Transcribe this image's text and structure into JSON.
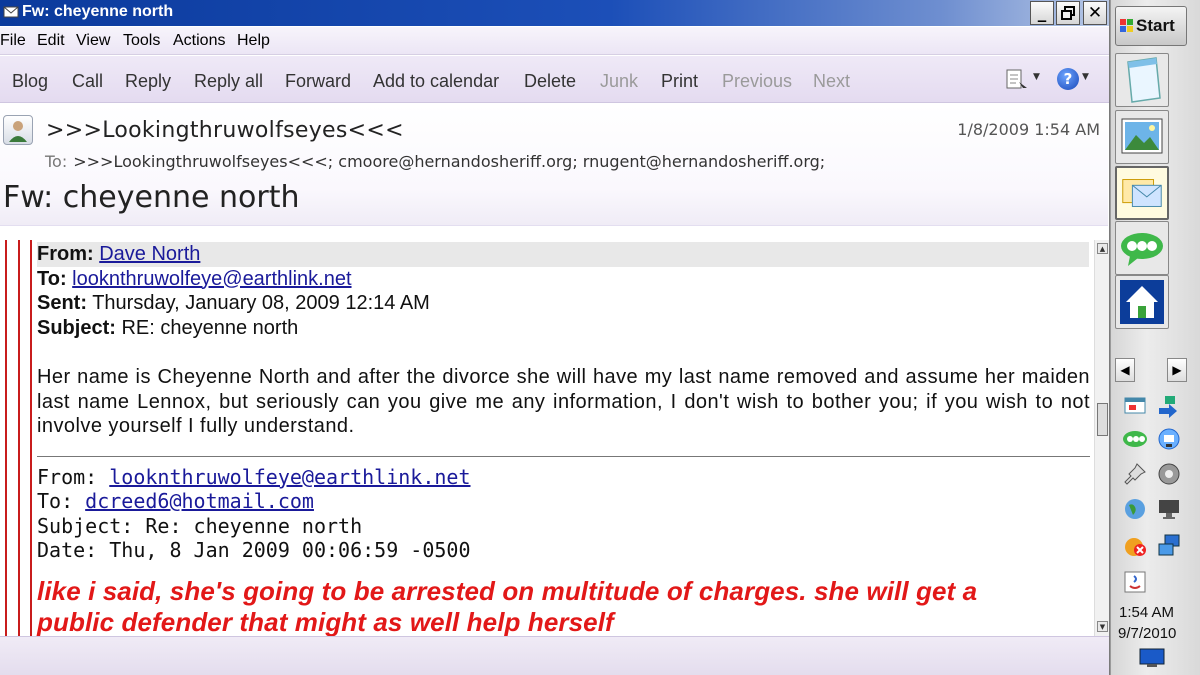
{
  "window": {
    "title": "Fw: cheyenne north"
  },
  "menu": [
    "File",
    "Edit",
    "View",
    "Tools",
    "Actions",
    "Help"
  ],
  "toolbar": {
    "blog": "Blog",
    "call": "Call",
    "reply": "Reply",
    "reply_all": "Reply all",
    "forward": "Forward",
    "add_to_calendar": "Add to calendar",
    "delete": "Delete",
    "junk": "Junk",
    "print": "Print",
    "previous": "Previous",
    "next": "Next"
  },
  "header": {
    "sender": ">>>Lookingthruwolfseyes<<<",
    "date": "1/8/2009 1:54 AM",
    "to_label": "To:",
    "to_value": ">>>Lookingthruwolfseyes<<<; cmoore@hernandosheriff.org; rnugent@hernandosheriff.org;",
    "subject": "Fw: cheyenne north"
  },
  "message": {
    "block1": {
      "from_label": "From:",
      "from_value": "Dave North",
      "to_label": "To:",
      "to_value": "lookn​thruwolfeye@earthlink.net",
      "sent_label": "Sent:",
      "sent_value": "Thursday, January 08, 2009 12:14 AM",
      "subject_label": "Subject:",
      "subject_value": "RE: cheyenne north"
    },
    "paragraph": "Her name is Cheyenne North and after the divorce she will have my last name removed and assume her maiden last name Lennox, but seriously can you give me any information, I don't wish to bother you; if you wish to not involve yourself I fully understand.",
    "block2": {
      "from_label": "From:",
      "from_value": "lookn​thruwolfeye@earthlink.net",
      "to_label": "To:",
      "to_value": "dcreed6@hotmail.com",
      "subject_label": "Subject:",
      "subject_value": "Re: cheyenne north",
      "date_label": "Date:",
      "date_value": "Thu, 8 Jan 2009 00:06:59 -0500"
    },
    "red_line": "like i said, she's going to be arrested on multitude of charges. she will get a",
    "red_line_2": "public defender that might as well help herself"
  },
  "taskbar": {
    "start": "Start",
    "clock_time": "1:54 AM",
    "clock_date": "9/7/2010",
    "items": [
      "notepad-icon",
      "photo-icon",
      "mail-icon",
      "messenger-icon",
      "home-icon"
    ]
  },
  "colors": {
    "title_bar": "#0b3a9c",
    "quote_bar": "#c81c1c",
    "emphasis_text": "#e21818",
    "link": "#1a1a9a"
  }
}
